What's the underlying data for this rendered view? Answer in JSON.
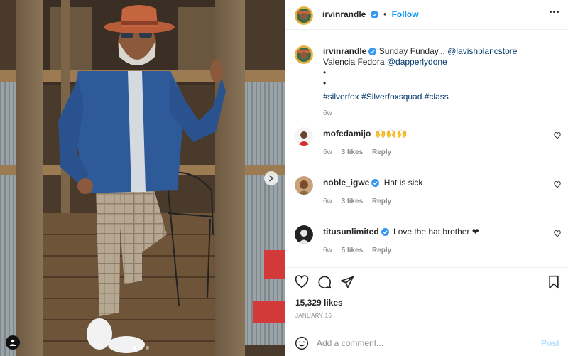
{
  "post": {
    "author": "irvinrandle",
    "follow_label": "Follow",
    "separator": "•"
  },
  "caption": {
    "username": "irvinrandle",
    "text_before": "Sunday Funday... ",
    "mention1": "@lavishblancstore",
    "text_middle": " Valencia Fedora ",
    "mention2": "@dapperlydone",
    "bullet1": "•",
    "bullet2": "•",
    "hashtags": "#silverfox #Silverfoxsquad #class",
    "time": "6w"
  },
  "comments": [
    {
      "username": "mofedamijo",
      "text": "🙌🙌🙌",
      "time": "6w",
      "likes": "3 likes",
      "reply": "Reply"
    },
    {
      "username": "noble_igwe",
      "text": "Hat is sick",
      "time": "6w",
      "likes": "3 likes",
      "reply": "Reply"
    },
    {
      "username": "titusunlimited",
      "text": "Love the hat brother ❤",
      "time": "6w",
      "likes": "5 likes",
      "reply": "Reply"
    }
  ],
  "stats": {
    "likes": "15,329 likes",
    "date": "JANUARY 16"
  },
  "composer": {
    "placeholder": "Add a comment...",
    "post_label": "Post"
  },
  "colors": {
    "accent": "#0095f6",
    "verified": "#3897f0",
    "link": "#00376b",
    "muted": "#8e8e8e"
  },
  "icons": [
    "verified-badge-icon",
    "more-options-icon",
    "heart-icon",
    "comment-icon",
    "share-icon",
    "bookmark-icon",
    "emoji-icon",
    "chevron-right-icon",
    "user-tag-icon"
  ]
}
